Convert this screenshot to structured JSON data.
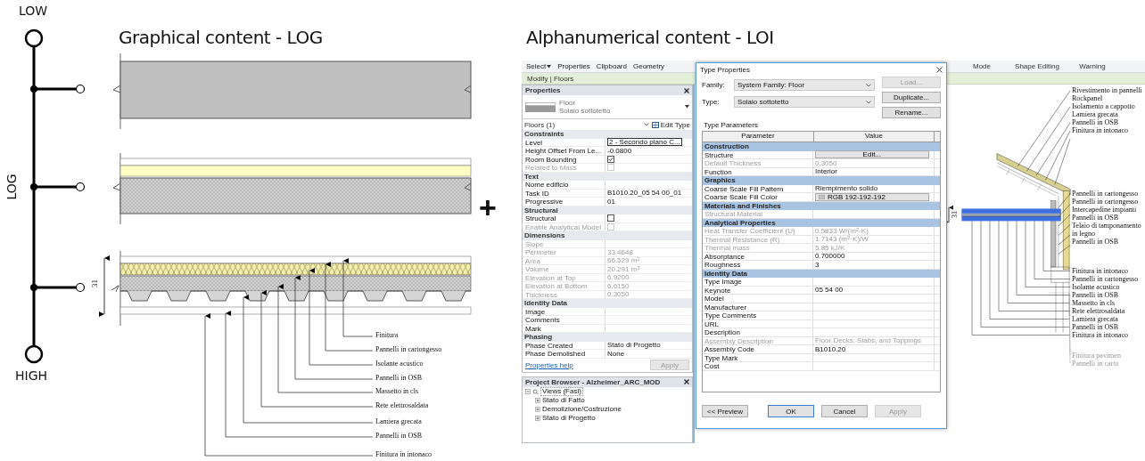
{
  "scale": {
    "low_label": "LOW",
    "high_label": "HIGH",
    "axis_label": "LOG"
  },
  "graphical": {
    "title": "Graphical content - LOG",
    "dimension": "31",
    "labels": [
      "Finitura",
      "Pannelli in cartongesso",
      "Isolante acustico",
      "Pannelli in OSB",
      "Massetto in cls",
      "Rete elettrosaldata",
      "Lamiera grecata",
      "Pannelli in OSB",
      "Finitura in intonaco"
    ]
  },
  "plus": "+",
  "alphanumerical": {
    "title": "Alphanumerical content - LOI"
  },
  "revit": {
    "ribbon": {
      "left_panels": [
        {
          "label": "Select",
          "dropdown": true
        },
        {
          "label": "Properties",
          "dropdown": false
        },
        {
          "label": "Clipboard",
          "dropdown": false
        },
        {
          "label": "Geometry",
          "dropdown": false
        }
      ],
      "right_panels": [
        "Mode",
        "Shape Editing",
        "Warning"
      ]
    },
    "context_tab": "Modify | Floors",
    "properties": {
      "title": "Properties",
      "type_name": "Floor",
      "type_sub": "Solaio sottotetto",
      "selector": "Floors (1)",
      "edit_type": "Edit Type",
      "groups": [
        {
          "name": "Constraints",
          "rows": [
            {
              "label": "Level",
              "value": "2 - Secondo piano C...",
              "kind": "field",
              "disabled": false
            },
            {
              "label": "Height Offset From Le...",
              "value": "-0.0800",
              "kind": "text",
              "disabled": false
            },
            {
              "label": "Room Bounding",
              "kind": "checkbox",
              "checked": true,
              "disabled": false
            },
            {
              "label": "Related to Mass",
              "kind": "checkbox",
              "checked": false,
              "disabled": true
            }
          ]
        },
        {
          "name": "Text",
          "rows": [
            {
              "label": "Nome edificio",
              "value": "",
              "kind": "text",
              "disabled": false
            },
            {
              "label": "Task ID",
              "value": "B1010.20_05 54 00_01",
              "kind": "text",
              "disabled": false
            },
            {
              "label": "Progressive",
              "value": "01",
              "kind": "text",
              "disabled": false
            }
          ]
        },
        {
          "name": "Structural",
          "rows": [
            {
              "label": "Structural",
              "kind": "checkbox",
              "checked": false,
              "disabled": false
            },
            {
              "label": "Enable Analytical Model",
              "kind": "checkbox",
              "checked": false,
              "disabled": true
            }
          ]
        },
        {
          "name": "Dimensions",
          "rows": [
            {
              "label": "Slope",
              "value": "",
              "kind": "text",
              "disabled": true
            },
            {
              "label": "Perimeter",
              "value": "33.4648",
              "kind": "text",
              "disabled": true
            },
            {
              "label": "Area",
              "value": "66.529 m$^{2}$",
              "kind": "text",
              "disabled": true
            },
            {
              "label": "Volume",
              "value": "20.291 m$^{3}$",
              "kind": "text",
              "disabled": true
            },
            {
              "label": "Elevation at Top",
              "value": "6.9200",
              "kind": "text",
              "disabled": true
            },
            {
              "label": "Elevation at Bottom",
              "value": "6.6150",
              "kind": "text",
              "disabled": true
            },
            {
              "label": "Thickness",
              "value": "0.3050",
              "kind": "text",
              "disabled": true
            }
          ]
        },
        {
          "name": "Identity Data",
          "rows": [
            {
              "label": "Image",
              "value": "",
              "kind": "text",
              "disabled": false
            },
            {
              "label": "Comments",
              "value": "",
              "kind": "text",
              "disabled": false
            },
            {
              "label": "Mark",
              "value": "",
              "kind": "text",
              "disabled": false
            }
          ]
        },
        {
          "name": "Phasing",
          "rows": [
            {
              "label": "Phase Created",
              "value": "Stato di Progetto",
              "kind": "text",
              "disabled": false
            },
            {
              "label": "Phase Demolished",
              "value": "None",
              "kind": "text",
              "disabled": false
            }
          ]
        }
      ],
      "help_link": "Properties help",
      "apply": {
        "label": "Apply",
        "disabled": true
      }
    },
    "project_browser": {
      "title": "Project Browser - Alzheimer_ARC_MOD",
      "tree": [
        {
          "label": "Views (Fasi)",
          "expanded": true,
          "children": [
            {
              "label": "Stato di Fatto",
              "expanded": false
            },
            {
              "label": "Demolizione/Costruzione",
              "expanded": false
            },
            {
              "label": "Stato di Progetto",
              "expanded": false
            }
          ]
        }
      ]
    },
    "type_properties": {
      "title": "Type Properties",
      "family_label": "Family:",
      "family_value": "System Family: Floor",
      "type_label": "Type:",
      "type_value": "Solaio sottotetto",
      "side_buttons": [
        {
          "label": "Load...",
          "disabled": true
        },
        {
          "label": "Duplicate...",
          "disabled": false
        },
        {
          "label": "Rename...",
          "disabled": false
        }
      ],
      "section_label": "Type Parameters",
      "columns": [
        "Parameter",
        "Value"
      ],
      "groups": [
        {
          "name": "Construction",
          "rows": [
            {
              "label": "Structure",
              "value": "Edit...",
              "kind": "button",
              "disabled": false
            },
            {
              "label": "Default Thickness",
              "value": "0.3050",
              "kind": "text",
              "disabled": true
            },
            {
              "label": "Function",
              "value": "Interior",
              "kind": "text",
              "disabled": false
            }
          ]
        },
        {
          "name": "Graphics",
          "rows": [
            {
              "label": "Coarse Scale Fill Pattern",
              "value": "Riempimento solido",
              "kind": "text",
              "disabled": false
            },
            {
              "label": "Coarse Scale Fill Color",
              "value": "RGB 192-192-192",
              "kind": "swatch",
              "disabled": false
            }
          ]
        },
        {
          "name": "Materials and Finishes",
          "rows": [
            {
              "label": "Structural Material",
              "value": "",
              "kind": "text",
              "disabled": true
            }
          ]
        },
        {
          "name": "Analytical Properties",
          "rows": [
            {
              "label": "Heat Transfer Coefficient (U)",
              "value": "0.5833 W/(m$^{2}$·K)",
              "kind": "text",
              "disabled": true
            },
            {
              "label": "Thermal Resistance (R)",
              "value": "1.7143 (m$^{2}$·K)/W",
              "kind": "text",
              "disabled": true
            },
            {
              "label": "Thermal mass",
              "value": "5.85 kJ/K",
              "kind": "text",
              "disabled": true
            },
            {
              "label": "Absorptance",
              "value": "0.700000",
              "kind": "text",
              "disabled": false
            },
            {
              "label": "Roughness",
              "value": "3",
              "kind": "text",
              "disabled": false
            }
          ]
        },
        {
          "name": "Identity Data",
          "rows": [
            {
              "label": "Type Image",
              "value": "",
              "kind": "text",
              "disabled": false
            },
            {
              "label": "Keynote",
              "value": "05 54 00",
              "kind": "text",
              "disabled": false
            },
            {
              "label": "Model",
              "value": "",
              "kind": "text",
              "disabled": false
            },
            {
              "label": "Manufacturer",
              "value": "",
              "kind": "text",
              "disabled": false
            },
            {
              "label": "Type Comments",
              "value": "",
              "kind": "text",
              "disabled": false
            },
            {
              "label": "URL",
              "value": "",
              "kind": "text",
              "disabled": false
            },
            {
              "label": "Description",
              "value": "",
              "kind": "text",
              "disabled": false
            },
            {
              "label": "Assembly Description",
              "value": "Floor Decks, Slabs, and Toppings",
              "kind": "text",
              "disabled": true
            },
            {
              "label": "Assembly Code",
              "value": "B1010.20",
              "kind": "text",
              "disabled": false
            },
            {
              "label": "Type Mark",
              "value": "",
              "kind": "text",
              "disabled": false
            },
            {
              "label": "Cost",
              "value": "",
              "kind": "text",
              "disabled": false
            }
          ]
        }
      ],
      "bottom_buttons": [
        {
          "label": "<< Preview",
          "disabled": false,
          "default": false
        },
        {
          "label": "OK",
          "disabled": false,
          "default": true
        },
        {
          "label": "Cancel",
          "disabled": false,
          "default": false
        },
        {
          "label": "Apply",
          "disabled": true,
          "default": false
        }
      ]
    },
    "detail": {
      "dimension": "31",
      "roof_labels": [
        "Rivestimento in pannelli Rockpanel",
        "Isolamento a cappotto",
        "Lamiera grecata",
        "Pannelli in OSB",
        "Finitura in intonaco"
      ],
      "floor_labels": [
        "Finitura in intonaco",
        "Pannelli in cartongesso",
        "Isolante acustico",
        "Pannelli in OSB",
        "Massetto in cls",
        "Rete elettrosaldata",
        "Lamiera grecata",
        "Pannelli in OSB",
        "Finitura in intonaco"
      ],
      "wall_labels": [
        "Pannelli in cartongesso",
        "Pannelli in cartongesso",
        "Intercapedine impianti",
        "Pannelli in OSB",
        "Telaio di tamponamento in legno",
        "Pannelli in OSB"
      ],
      "lower_labels": [
        "Finitura pavimen",
        "Pannelli in carto"
      ]
    }
  }
}
